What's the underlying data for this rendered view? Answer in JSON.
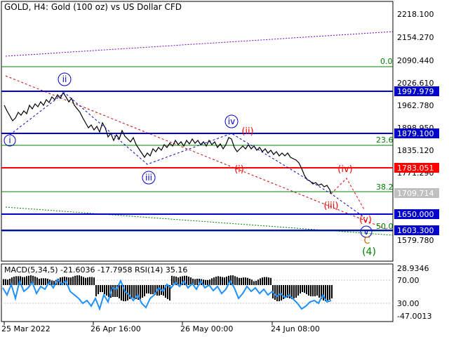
{
  "header": {
    "symbol_timeframe": "GOLD, H4:",
    "instrument": "Gold (100 oz) vs US Dollar CFD"
  },
  "indicator_header": "MACD(5,34,5) -21.6036 -17.7958 RSI(14) 35.16",
  "chart_data": {
    "type": "line",
    "price_axis_ticks": [
      "2218.100",
      "2154.270",
      "2090.440",
      "2026.610",
      "1962.780",
      "1898.950",
      "1835.120",
      "1771.290",
      "1579.780"
    ],
    "x_axis_ticks": [
      "25 Mar 2022",
      "26 Apr 16:00",
      "26 May 00:00",
      "24 Jun 08:00"
    ],
    "levels": [
      {
        "value": "1997.979",
        "color": "#0000cc"
      },
      {
        "value": "1879.100",
        "color": "#0000cc"
      },
      {
        "value": "1783.051",
        "color": "#ff0000"
      },
      {
        "value": "1709.714",
        "color": "#c0c0c0"
      },
      {
        "value": "1650.000",
        "color": "#0000cc"
      },
      {
        "value": "1603.300",
        "color": "#0000cc"
      }
    ],
    "fib_labels": [
      "0.0",
      "23.6",
      "38.2",
      "50.0"
    ],
    "wave_labels": {
      "blue": [
        "i",
        "ii",
        "iii",
        "iv",
        "v"
      ],
      "red": [
        "(i)",
        "(ii)",
        "(iii)",
        "(iv)",
        "(v)"
      ],
      "orange": [
        "C"
      ],
      "green": [
        "(4)"
      ]
    },
    "indicator_ticks": [
      "28.9346",
      "70.00",
      "30.00",
      "-47.0013"
    ]
  }
}
